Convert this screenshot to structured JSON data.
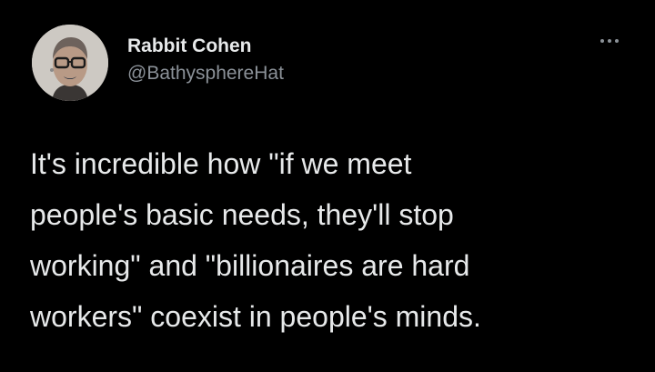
{
  "tweet": {
    "author": {
      "display_name": "Rabbit Cohen",
      "handle": "@BathysphereHat",
      "avatar_icon": "avatar-photo"
    },
    "more_icon": "ellipsis-icon",
    "text_lines": [
      "It's incredible how \"if we meet",
      "people's basic needs, they'll stop",
      "working\" and \"billionaires are hard",
      "workers\" coexist in people's minds."
    ]
  },
  "colors": {
    "background": "#000000",
    "text_primary": "#e7e9ea",
    "text_secondary": "#8b9198"
  }
}
